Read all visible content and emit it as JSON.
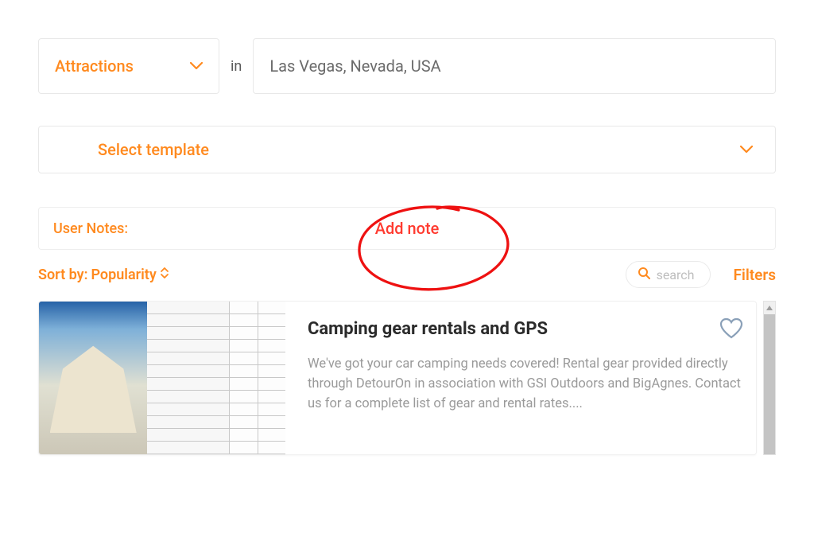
{
  "top": {
    "category_label": "Attractions",
    "in_text": "in",
    "location_value": "Las Vegas, Nevada, USA"
  },
  "template": {
    "label": "Select template"
  },
  "notes": {
    "label": "User Notes:",
    "add_note": "Add note"
  },
  "controls": {
    "sort_by_prefix": "Sort by: ",
    "sort_by_value": "Popularity",
    "search_label": "search",
    "filters_label": "Filters"
  },
  "results": [
    {
      "title": "Camping gear rentals and GPS",
      "description": "We've got your car camping needs covered! Rental gear provided directly through DetourOn in association with GSI Outdoors and BigAgnes. Contact us for a complete list of gear and rental rates...."
    }
  ],
  "colors": {
    "accent": "#ff8a1f",
    "danger": "#ff3b30",
    "muted": "#9a9a9a"
  }
}
